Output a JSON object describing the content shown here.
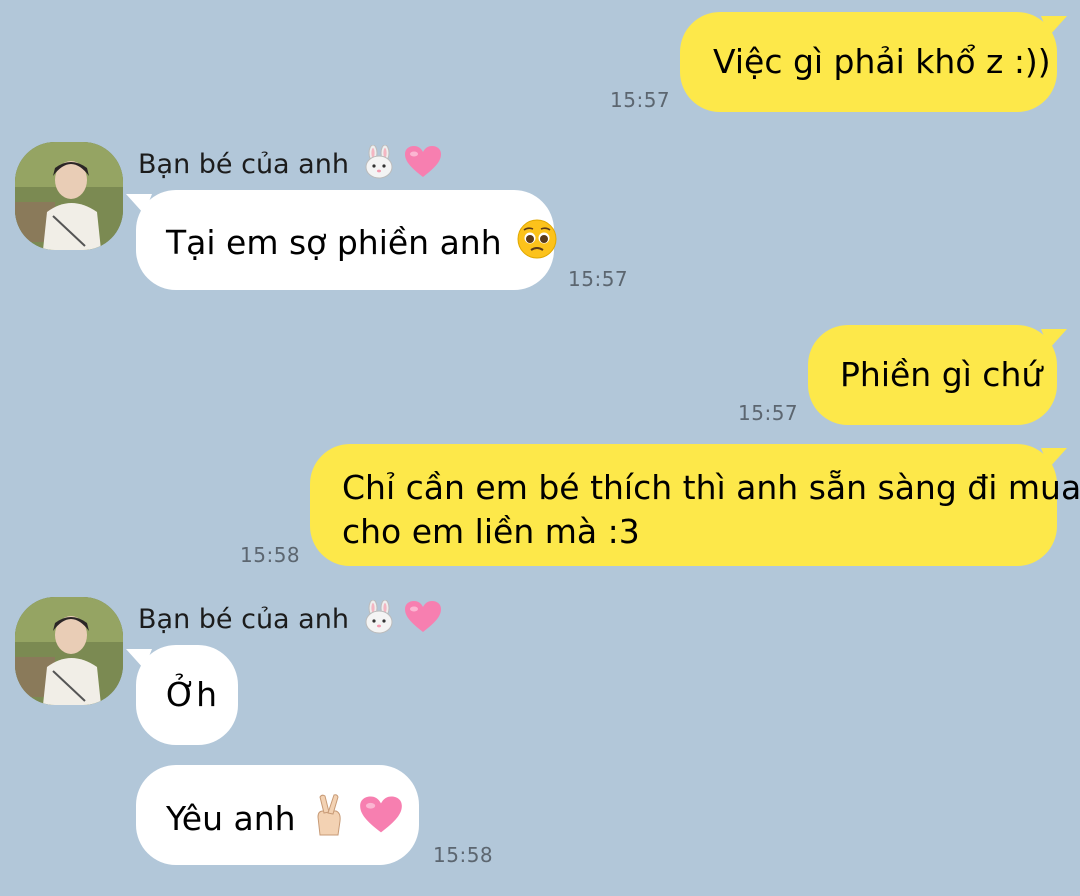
{
  "chat": {
    "sender_name": "Bạn bé của anh",
    "sender_emoji": "rabbit-face-and-pink-heart",
    "colors": {
      "background": "#b2c7d9",
      "my_bubble": "#fde84a",
      "their_bubble": "#ffffff",
      "timestamp": "#5c6670"
    },
    "messages": [
      {
        "from": "me",
        "text": "Việc gì phải khổ z :))",
        "time": "15:57"
      },
      {
        "from": "them",
        "text": "Tại em sợ phiền anh",
        "emoji": "pleading-face",
        "time": "15:57"
      },
      {
        "from": "me",
        "text": "Phiền gì chứ",
        "time": "15:57"
      },
      {
        "from": "me",
        "lines": [
          "Chỉ cần em bé thích thì anh sẵn sàng đi mua",
          "cho em liền mà :3"
        ],
        "time": "15:58"
      },
      {
        "from": "them",
        "text": "Ởh"
      },
      {
        "from": "them",
        "text": "Yêu anh",
        "emoji": "crossed-fingers-and-pink-heart",
        "time": "15:58"
      }
    ]
  }
}
